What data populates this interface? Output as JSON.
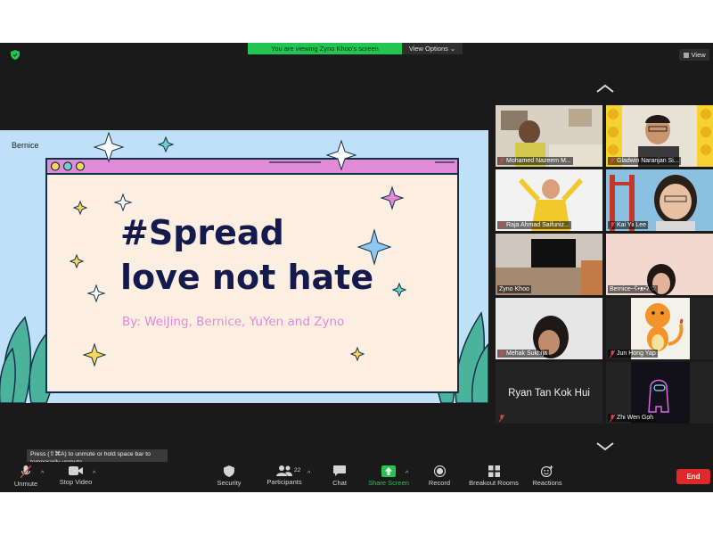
{
  "banner": {
    "message": "You are viewing Zyno Khoo's screen",
    "view_options": "View Options ⌄"
  },
  "view_button": "View",
  "shared_screen": {
    "owner_label": "Bernice",
    "slide": {
      "title_line1": "#Spread",
      "title_line2": "love not hate",
      "byline": "By: WeiJing, Bernice, YuYen and Zyno"
    }
  },
  "participants": [
    {
      "name": "Mohamed Nazeem M...",
      "muted": true
    },
    {
      "name": "Gladwin Naranjan Si...",
      "muted": true
    },
    {
      "name": "Raja Ahmad Saifuniz...",
      "muted": true
    },
    {
      "name": "Kai Yii Lee",
      "muted": true
    },
    {
      "name": "Zyno Khoo",
      "muted": false
    },
    {
      "name": "Bernice~ʕ•ᴥ•ʔ ♡",
      "muted": true,
      "active": true
    },
    {
      "name": "Mehak Sukhija",
      "muted": true
    },
    {
      "name": "Jun Hong Yap",
      "muted": true
    },
    {
      "name": "Ryan Tan Kok Hui",
      "muted": true,
      "video_off": true
    },
    {
      "name": "Zhi Wen Goh",
      "muted": true
    }
  ],
  "tooltip": "Press (⇧⌘A) to unmute or hold space bar to temporarily unmute.",
  "toolbar": {
    "unmute": "Unmute",
    "stop_video": "Stop Video",
    "security": "Security",
    "participants": "Participants",
    "participant_count": "22",
    "chat": "Chat",
    "share_screen": "Share Screen",
    "record": "Record",
    "breakout_rooms": "Breakout Rooms",
    "reactions": "Reactions",
    "end": "End"
  },
  "colors": {
    "accent_green": "#23c552",
    "end_red": "#e02828",
    "slide_navy": "#141a4d",
    "slide_pink": "#e18bd6"
  }
}
